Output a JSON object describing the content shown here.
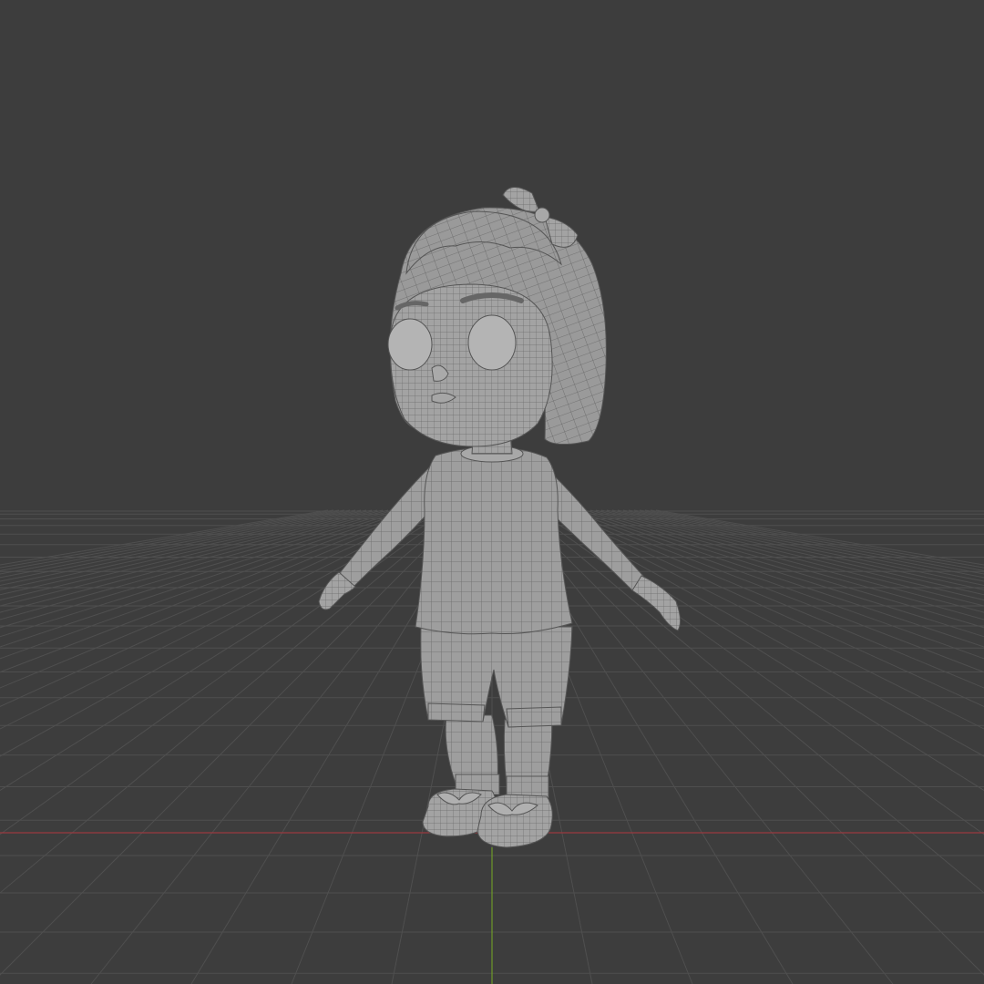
{
  "viewport": {
    "background_color": "#3d3d3d",
    "grid_color": "#4f4f4f",
    "x_axis_color": "#9a3a40",
    "y_axis_color": "#6e9a2a",
    "mesh_fill_color": "#9c9c9c",
    "mesh_wire_color": "#5e5e5e",
    "grid_visible": true,
    "wireframe_overlay": true,
    "object": {
      "type": "character-mesh",
      "description_label": "",
      "pose": "t-pose"
    }
  }
}
